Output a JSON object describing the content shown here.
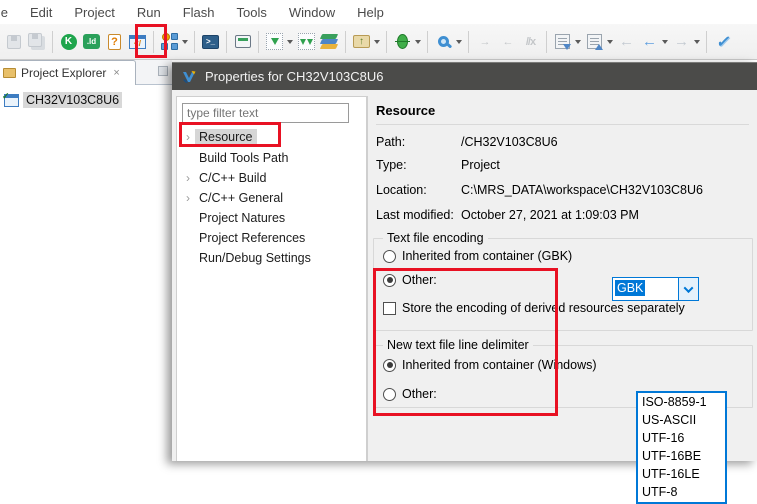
{
  "colors": {
    "annotation_red": "#e81123",
    "title_bar": "#4b4b49",
    "selection_blue": "#0078d7",
    "dialog_bg": "#f0f0f0",
    "tree_selection": "#d6d6d6"
  },
  "menu": {
    "items": [
      "File",
      "Edit",
      "Project",
      "Run",
      "Flash",
      "Tools",
      "Window",
      "Help"
    ]
  },
  "toolbar": {
    "glyphs": {
      "k": "K",
      "ld": ".ld",
      "help": "?",
      "code": "</",
      "terminal": ">_",
      "folder_up": "↑",
      "indent_right": "→",
      "indent_left": "←",
      "no_format": "//x",
      "back": "←",
      "forward": "→",
      "swoosh": "✓"
    }
  },
  "explorer": {
    "tab_label": "Project Explorer",
    "tab_close_glyph": "×",
    "project_name": "CH32V103C8U6"
  },
  "dialog": {
    "title": "Properties for CH32V103C8U6",
    "filter_placeholder": "type filter text",
    "tree_arrow_glyph": "›",
    "tree": {
      "items": [
        {
          "label": "Resource"
        },
        {
          "label": "Build Tools Path"
        },
        {
          "label": "C/C++ Build"
        },
        {
          "label": "C/C++ General"
        },
        {
          "label": "Project Natures"
        },
        {
          "label": "Project References"
        },
        {
          "label": "Run/Debug Settings"
        }
      ]
    },
    "content": {
      "heading": "Resource",
      "info": {
        "path_label": "Path:",
        "path_value": "/CH32V103C8U6",
        "type_label": "Type:",
        "type_value": "Project",
        "location_label": "Location:",
        "location_value": "C:\\MRS_DATA\\workspace\\CH32V103C8U6",
        "modified_label": "Last modified:",
        "modified_value": "October 27, 2021 at 1:09:03 PM"
      },
      "encoding_group": {
        "title": "Text file encoding",
        "inherited_label": "Inherited from container (GBK)",
        "other_label": "Other:",
        "combo_value": "GBK",
        "store_label": "Store the encoding of derived resources separately",
        "options": [
          "ISO-8859-1",
          "US-ASCII",
          "UTF-16",
          "UTF-16BE",
          "UTF-16LE",
          "UTF-8"
        ]
      },
      "delimiter_group": {
        "title": "New text file line delimiter",
        "inherited_label": "Inherited from container (Windows)",
        "other_label": "Other:"
      }
    }
  }
}
